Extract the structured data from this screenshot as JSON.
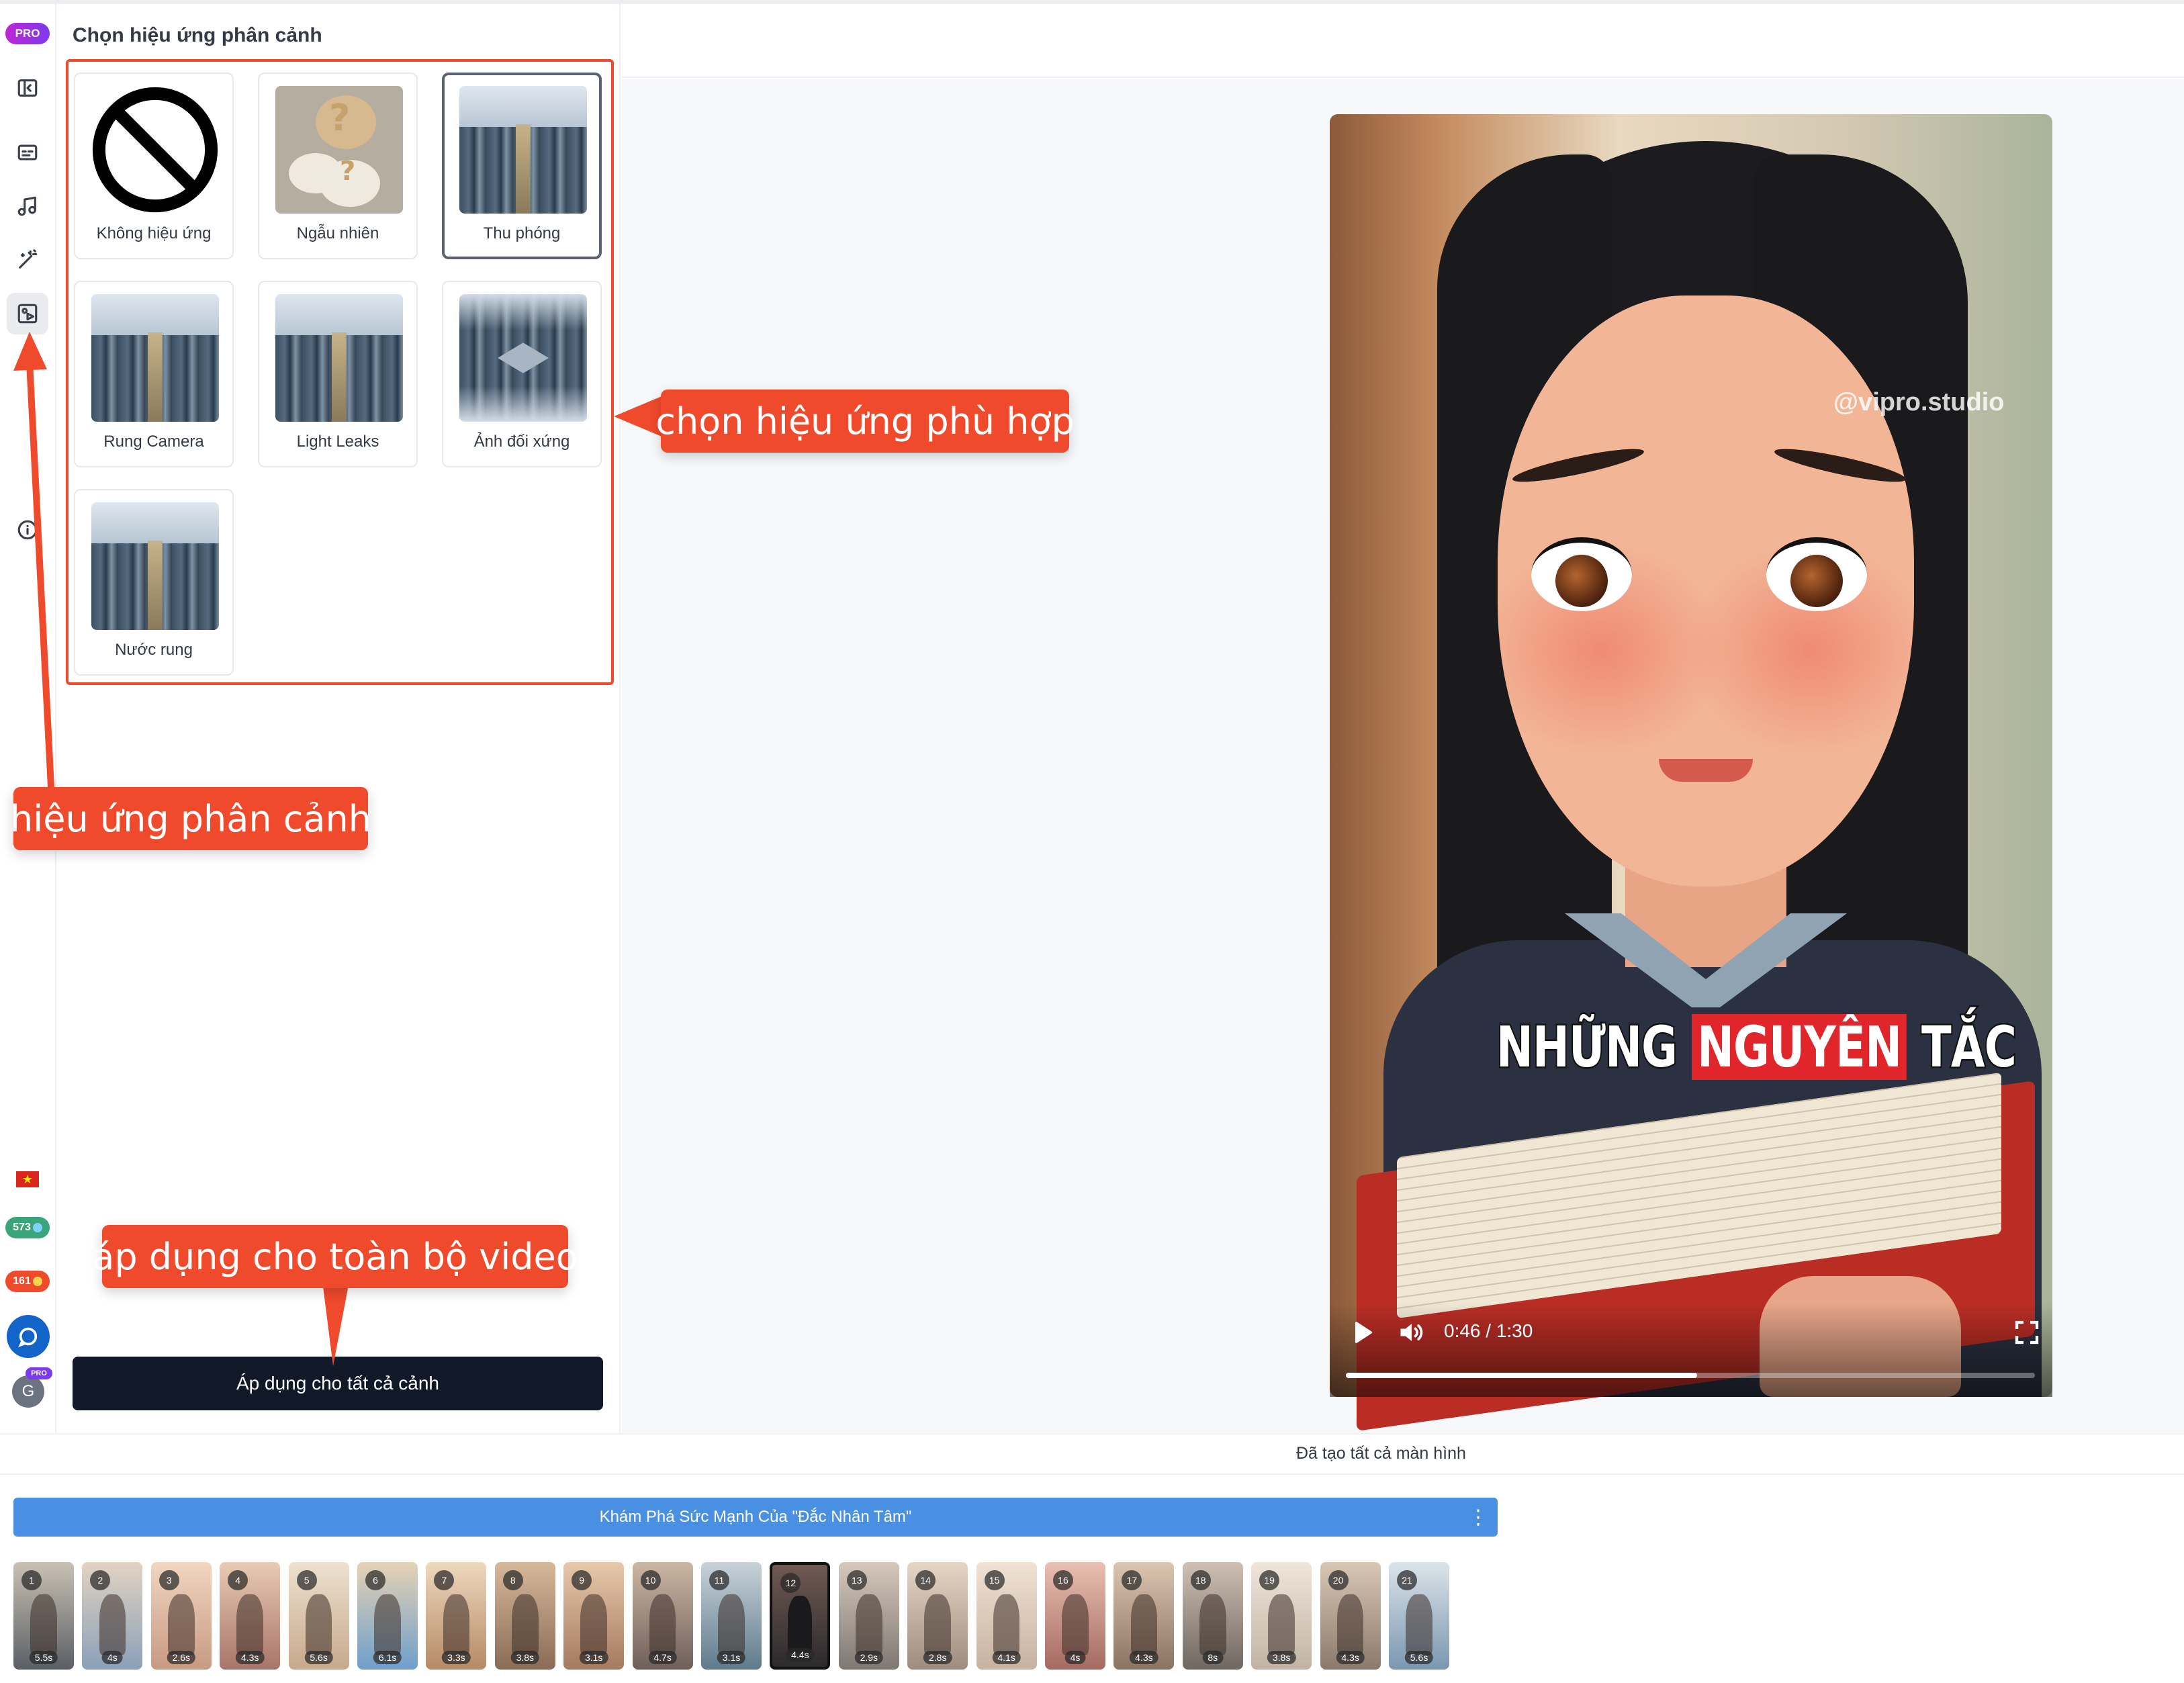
{
  "rail": {
    "pro_badge": "PRO",
    "icons": [
      "sidebar-collapse-icon",
      "subtitles-icon",
      "music-icon",
      "magic-wand-icon",
      "scene-effect-icon",
      "info-icon"
    ],
    "credits": [
      {
        "value": "573",
        "color": "#3aa57a"
      },
      {
        "value": "161",
        "color": "#ef4a2c"
      }
    ],
    "avatar_initial": "G",
    "avatar_badge": "PRO"
  },
  "panel": {
    "title": "Chọn hiệu ứng phân cảnh",
    "effects": [
      {
        "label": "Không hiệu ứng",
        "thumb": "no-effect"
      },
      {
        "label": "Ngẫu nhiên",
        "thumb": "random"
      },
      {
        "label": "Thu phóng",
        "thumb": "city",
        "selected": true
      },
      {
        "label": "Rung Camera",
        "thumb": "city"
      },
      {
        "label": "Light Leaks",
        "thumb": "city"
      },
      {
        "label": "Ảnh đối xứng",
        "thumb": "mirror"
      },
      {
        "label": "Nước rung",
        "thumb": "city"
      }
    ],
    "apply_button": "Áp dụng cho tất cả cảnh"
  },
  "preview": {
    "watermark": "@vipro.studio",
    "caption": [
      "NHỮNG",
      "NGUYÊN",
      "TẮC"
    ],
    "time": "0:46 / 1:30",
    "progress": 0.51
  },
  "annotations": {
    "choose_effect": "chọn hiệu ứng phù hợp",
    "scene_effect": "hiệu ứng phân cảnh",
    "apply_all": "áp dụng cho toàn bộ video"
  },
  "status": "Đã tạo tất cả màn hình",
  "project_title": "Khám Phá Sức Mạnh Của \"Đắc Nhân Tâm\"",
  "scenes": [
    {
      "n": "1",
      "dur": "5.5s"
    },
    {
      "n": "2",
      "dur": "4s"
    },
    {
      "n": "3",
      "dur": "2.6s"
    },
    {
      "n": "4",
      "dur": "4.3s"
    },
    {
      "n": "5",
      "dur": "5.6s"
    },
    {
      "n": "6",
      "dur": "6.1s"
    },
    {
      "n": "7",
      "dur": "3.3s"
    },
    {
      "n": "8",
      "dur": "3.8s"
    },
    {
      "n": "9",
      "dur": "3.1s"
    },
    {
      "n": "10",
      "dur": "4.7s"
    },
    {
      "n": "11",
      "dur": "3.1s"
    },
    {
      "n": "12",
      "dur": "4.4s",
      "active": true
    },
    {
      "n": "13",
      "dur": "2.9s"
    },
    {
      "n": "14",
      "dur": "2.8s"
    },
    {
      "n": "15",
      "dur": "4.1s"
    },
    {
      "n": "16",
      "dur": "4s"
    },
    {
      "n": "17",
      "dur": "4.3s"
    },
    {
      "n": "18",
      "dur": "8s"
    },
    {
      "n": "19",
      "dur": "3.8s"
    },
    {
      "n": "20",
      "dur": "4.3s"
    },
    {
      "n": "21",
      "dur": "5.6s"
    }
  ],
  "colors": {
    "accent": "#ef4a2c",
    "project_bar": "#4a90e2",
    "button_dark": "#111827"
  }
}
